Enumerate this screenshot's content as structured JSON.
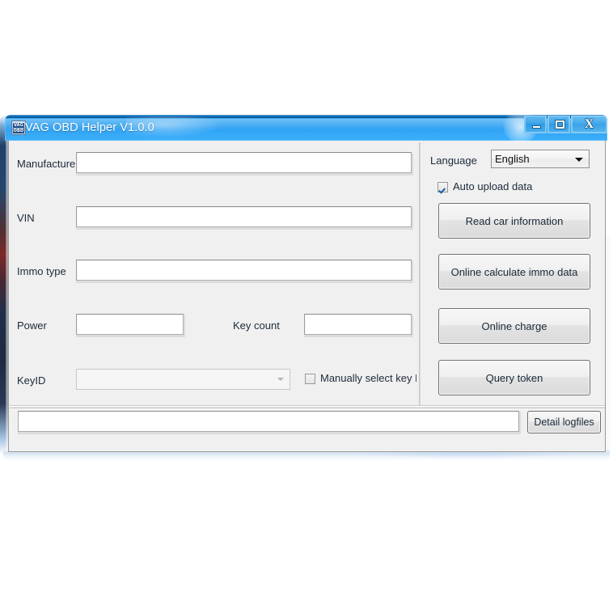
{
  "window": {
    "title": "VAG OBD Helper V1.0.0",
    "icon_line1": "VAG",
    "icon_line2": "OBD",
    "minimize_label": "",
    "maximize_label": "",
    "close_label": "X",
    "accent_color": "#2ea0f2",
    "client_bg": "#f0f0f0"
  },
  "form": {
    "fields": [
      {
        "label": "Manufacture",
        "value": "",
        "placeholder": ""
      },
      {
        "label": "VIN",
        "value": "",
        "placeholder": ""
      },
      {
        "label": "Immo type",
        "value": "",
        "placeholder": ""
      },
      {
        "label": "Power",
        "value": "",
        "placeholder": ""
      },
      {
        "label": "Key count",
        "value": "",
        "placeholder": ""
      }
    ],
    "keyid": {
      "label": "KeyID",
      "value": "",
      "enabled": false
    },
    "manual_key": {
      "label": "Manually select key I",
      "checked": false
    }
  },
  "sidebar": {
    "language": {
      "label": "Language",
      "value": "English",
      "options": [
        "English"
      ]
    },
    "auto_upload": {
      "label": "Auto upload data",
      "checked": true
    },
    "buttons": [
      {
        "label": "Read car information"
      },
      {
        "label": "Online calculate immo data"
      },
      {
        "label": "Online charge"
      },
      {
        "label": "Query token"
      }
    ]
  },
  "statusbar": {
    "log_value": "",
    "log_placeholder": "",
    "detail_button": "Detail logfiles"
  }
}
